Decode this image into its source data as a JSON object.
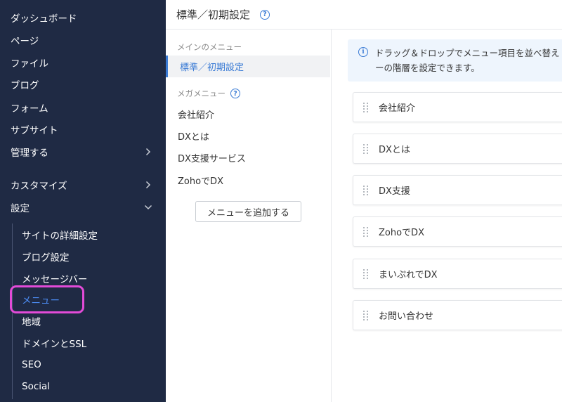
{
  "sidebar": {
    "items": [
      {
        "label": "ダッシュボード"
      },
      {
        "label": "ページ"
      },
      {
        "label": "ファイル"
      },
      {
        "label": "ブログ"
      },
      {
        "label": "フォーム"
      },
      {
        "label": "サブサイト"
      },
      {
        "label": "管理する",
        "icon": "chevron-right-icon"
      },
      {
        "label": "カスタマイズ",
        "icon": "chevron-right-icon"
      },
      {
        "label": "設定",
        "icon": "chevron-down-icon"
      }
    ],
    "sub_items": [
      {
        "label": "サイトの詳細設定"
      },
      {
        "label": "ブログ設定"
      },
      {
        "label": "メッセージバー"
      },
      {
        "label": "メニュー",
        "active": true
      },
      {
        "label": "地域"
      },
      {
        "label": "ドメインとSSL"
      },
      {
        "label": "SEO"
      },
      {
        "label": "Social"
      }
    ]
  },
  "header": {
    "title": "標準／初期設定",
    "help_icon": "?"
  },
  "menu_panel": {
    "main_section_label": "メインのメニュー",
    "main_item": "標準／初期設定",
    "mega_section_label": "メガメニュー",
    "mega_help_icon": "?",
    "mega_items": [
      "会社紹介",
      "DXとは",
      "DX支援サービス",
      "ZohoでDX"
    ],
    "add_button": "メニューを追加する"
  },
  "info": {
    "icon": "i",
    "line1": "ドラッグ＆ドロップでメニュー項目を並べ替え",
    "line2": "ーの階層を設定できます。"
  },
  "menu_items": [
    "会社紹介",
    "DXとは",
    "DX支援",
    "ZohoでDX",
    "まいぷれでDX",
    "お問い合わせ"
  ],
  "colors": {
    "sidebar_bg": "#1f2a44",
    "accent": "#3a7bd5",
    "highlight": "#e24bd8"
  }
}
